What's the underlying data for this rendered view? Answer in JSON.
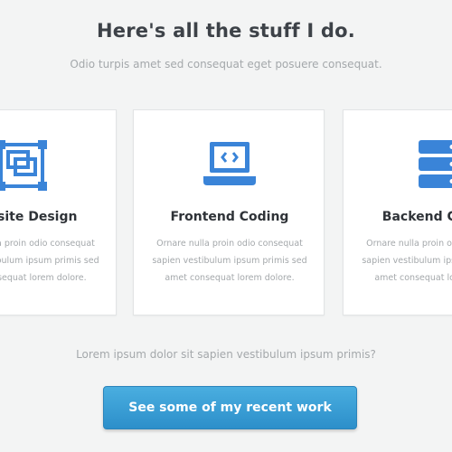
{
  "header": {
    "title": "Here's all the stuff I do.",
    "subtitle": "Odio turpis amet sed consequat eget posuere consequat."
  },
  "services": [
    {
      "icon": "website-design-icon",
      "title": "Website Design",
      "lines": [
        "Ornare nulla proin odio consequat",
        "sapien vestibulum ipsum primis sed",
        "amet consequat lorem dolore."
      ]
    },
    {
      "icon": "laptop-code-icon",
      "title": "Frontend Coding",
      "lines": [
        "Ornare nulla proin odio consequat",
        "sapien vestibulum ipsum primis sed",
        "amet consequat lorem dolore."
      ]
    },
    {
      "icon": "server-icon",
      "title": "Backend Coding",
      "lines": [
        "Ornare nulla proin odio consequat",
        "sapien vestibulum ipsum primis sed",
        "amet consequat lorem dolore."
      ]
    }
  ],
  "footer": {
    "lead": "Lorem ipsum dolor sit sapien vestibulum ipsum primis?",
    "button_label": "See some of my recent work"
  },
  "colors": {
    "icon": "#3a84d8",
    "button": "#3a9fd6"
  }
}
